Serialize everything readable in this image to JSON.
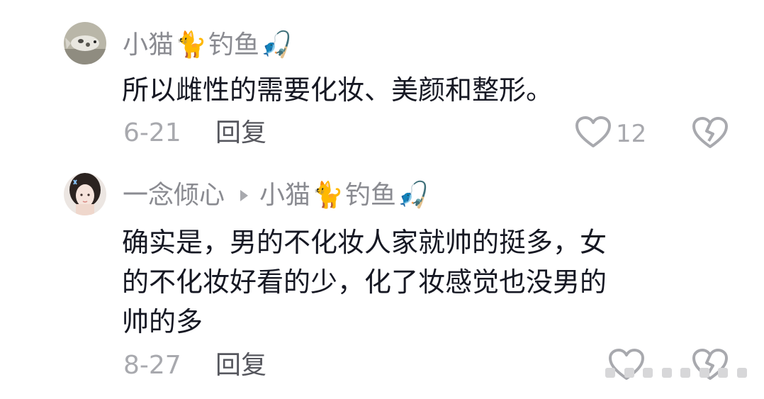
{
  "comments": [
    {
      "username": "小猫",
      "username_suffix": "钓鱼",
      "emoji_cat": "🐈",
      "emoji_fishing": "🎣",
      "text": "所以雌性的需要化妆、美颜和整形。",
      "date": "6-21",
      "reply_label": "回复",
      "likes": "12"
    },
    {
      "username": "一念倾心",
      "reply_to_name": "小猫",
      "reply_to_suffix": "钓鱼",
      "emoji_cat": "🐈",
      "emoji_fishing": "🎣",
      "text": "确实是，男的不化妆人家就帅的挺多，女\n的不化妆好看的少，化了妆感觉也没男的\n帅的多",
      "date": "8-27",
      "reply_label": "回复"
    }
  ],
  "colors": {
    "text_primary": "#161823",
    "text_name": "#8a8b91",
    "text_meta": "#a8a9ae",
    "icon_stroke": "#a8a9ae"
  },
  "icons": [
    "heart-outline-icon",
    "dislike-broken-heart-icon",
    "reply-arrow-icon"
  ]
}
